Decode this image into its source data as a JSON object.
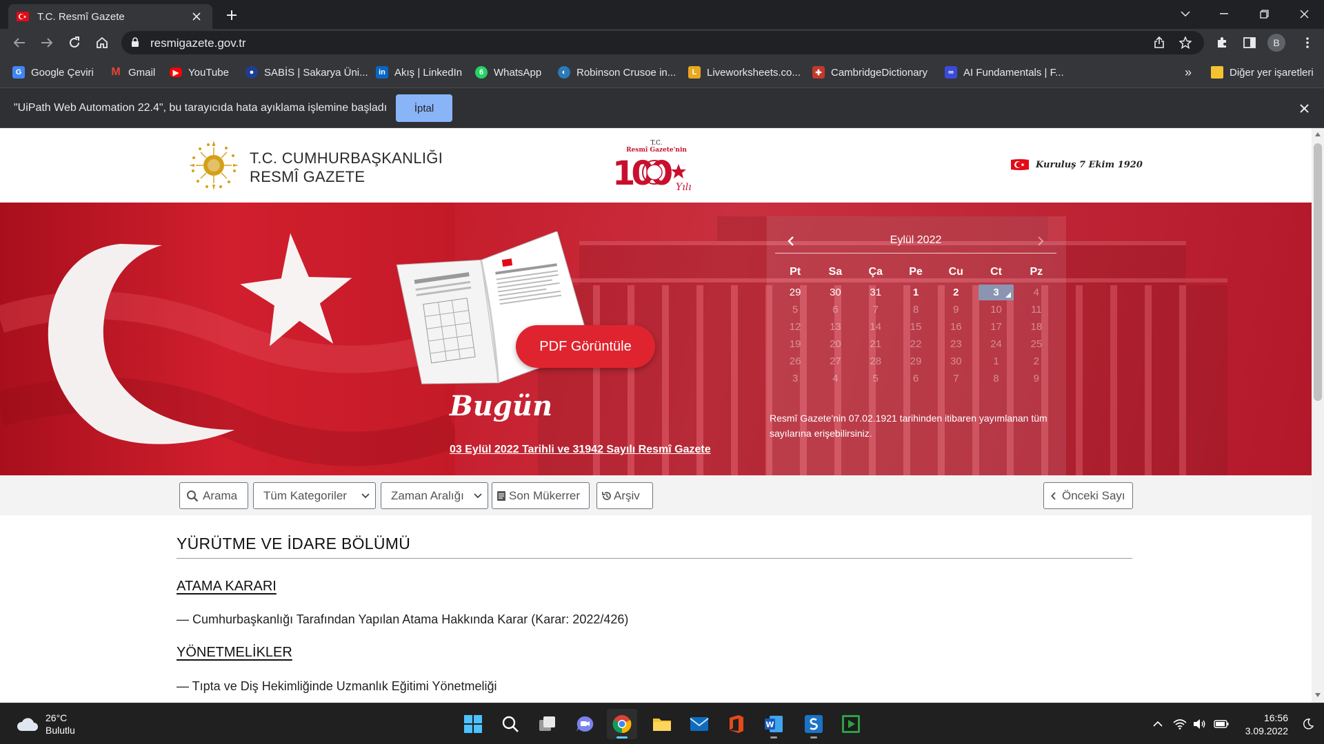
{
  "browser": {
    "tab_title": "T.C. Resmî Gazete",
    "url": "resmigazete.gov.tr",
    "profile_initial": "B"
  },
  "bookmarks": [
    {
      "label": "Google Çeviri",
      "icon": "google-translate-icon",
      "color": "#4285f4"
    },
    {
      "label": "Gmail",
      "icon": "gmail-icon",
      "color": "#ea4335"
    },
    {
      "label": "YouTube",
      "icon": "youtube-icon",
      "color": "#ff0000"
    },
    {
      "label": "SABİS | Sakarya Üni...",
      "icon": "sabis-icon",
      "color": "#1c3f94"
    },
    {
      "label": "Akış | LinkedIn",
      "icon": "linkedin-icon",
      "color": "#0a66c2"
    },
    {
      "label": "WhatsApp",
      "icon": "whatsapp-icon",
      "color": "#25d366"
    },
    {
      "label": "Robinson Crusoe in...",
      "icon": "book-site-icon",
      "color": "#2a7ab8"
    },
    {
      "label": "Liveworksheets.co...",
      "icon": "liveworksheets-icon",
      "color": "#e9a820"
    },
    {
      "label": "CambridgeDictionary",
      "icon": "cambridge-icon",
      "color": "#c13a2c"
    },
    {
      "label": "AI Fundamentals | F...",
      "icon": "ai-fundamentals-icon",
      "color": "#3b4bd8"
    }
  ],
  "bookmarks_overflow": "»",
  "other_bookmarks": "Diğer yer işaretleri",
  "infobar": {
    "message": "\"UiPath Web Automation 22.4\", bu tarayıcıda hata ayıklama işlemine başladı",
    "cancel_label": "İptal"
  },
  "site": {
    "title_line1": "T.C. CUMHURBAŞKANLIĞI",
    "title_line2": "RESMÎ GAZETE",
    "centennial_top": "T.C.",
    "centennial_sub": "Resmî Gazete'nin",
    "centennial_number": "100",
    "centennial_word": "Yılı",
    "founded": "Kuruluş 7 Ekim 1920"
  },
  "hero": {
    "pdf_button": "PDF Görüntüle",
    "today_title": "Bugün",
    "today_link": "03 Eylül 2022 Tarihli ve 31942 Sayılı Resmî Gazete"
  },
  "calendar": {
    "month": "Eylül 2022",
    "weekdays": [
      "Pt",
      "Sa",
      "Ça",
      "Pe",
      "Cu",
      "Ct",
      "Pz"
    ],
    "weeks": [
      [
        "29",
        "30",
        "31",
        "1",
        "2",
        "3",
        "4"
      ],
      [
        "5",
        "6",
        "7",
        "8",
        "9",
        "10",
        "11"
      ],
      [
        "12",
        "13",
        "14",
        "15",
        "16",
        "17",
        "18"
      ],
      [
        "19",
        "20",
        "21",
        "22",
        "23",
        "24",
        "25"
      ],
      [
        "26",
        "27",
        "28",
        "29",
        "30",
        "1",
        "2"
      ],
      [
        "3",
        "4",
        "5",
        "6",
        "7",
        "8",
        "9"
      ]
    ],
    "note": "Resmî Gazete'nin 07.02.1921 tarihinden itibaren yayımlanan tüm sayılarına erişebilirsiniz."
  },
  "filters": {
    "search": "Arama",
    "category": "Tüm Kategoriler",
    "date_range": "Zaman Aralığı",
    "repeated": "Son Mükerrer",
    "archive": "Arşiv",
    "previous": "Önceki Sayı"
  },
  "content": {
    "section_title": "YÜRÜTME VE İDARE BÖLÜMÜ",
    "subsections": [
      {
        "title": "ATAMA KARARI",
        "items": [
          "— Cumhurbaşkanlığı Tarafından Yapılan Atama Hakkında Karar (Karar: 2022/426)"
        ]
      },
      {
        "title": "YÖNETMELİKLER",
        "items": [
          "— Tıpta ve Diş Hekimliğinde Uzmanlık Eğitimi Yönetmeliği"
        ]
      }
    ]
  },
  "taskbar": {
    "temperature": "26°C",
    "weather": "Bulutlu",
    "time": "16:56",
    "date": "3.09.2022"
  }
}
